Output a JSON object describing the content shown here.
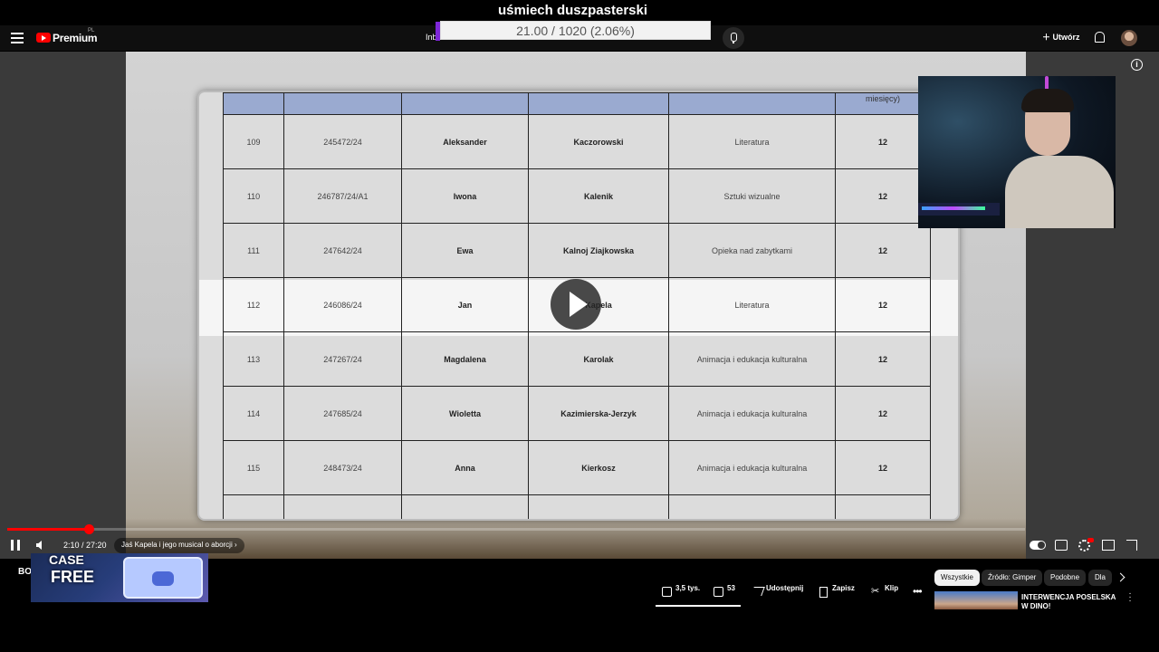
{
  "stream": {
    "title": "uśmiech duszpasterski",
    "progress_text": "21.00 / 1020 (2.06%)",
    "progress_fraction": 0.0206
  },
  "header": {
    "brand": "Premium",
    "region": "PL",
    "search_fragment": "Inb",
    "create_label": "Utwórz"
  },
  "table": {
    "header_last": "miesięcy)",
    "rows": [
      [
        "109",
        "245472/24",
        "Aleksander",
        "Kaczorowski",
        "Literatura",
        "12"
      ],
      [
        "110",
        "246787/24/A1",
        "Iwona",
        "Kalenik",
        "Sztuki wizualne",
        "12"
      ],
      [
        "111",
        "247642/24",
        "Ewa",
        "Kalnoj Ziajkowska",
        "Opieka nad zabytkami",
        "12"
      ],
      [
        "112",
        "246086/24",
        "Jan",
        "Kapela",
        "Literatura",
        "12"
      ],
      [
        "113",
        "247267/24",
        "Magdalena",
        "Karolak",
        "Animacja i edukacja kulturalna",
        "12"
      ],
      [
        "114",
        "247685/24",
        "Wioletta",
        "Kazimierska-Jerzyk",
        "Animacja i edukacja kulturalna",
        "12"
      ],
      [
        "115",
        "248473/24",
        "Anna",
        "Kierkosz",
        "Animacja i edukacja kulturalna",
        "12"
      ]
    ]
  },
  "player": {
    "time": "2:10 / 27:20",
    "chapter": "Jaś Kapela i jego musical o aborcji",
    "played_fraction": 0.08
  },
  "below": {
    "channel_fragment": "BO",
    "promo_line1": "CASE",
    "promo_line2": "FREE",
    "likes": "3,5 tys.",
    "dislikes": "53",
    "share": "Udostępnij",
    "save": "Zapisz",
    "clip": "Klip"
  },
  "chips": [
    "Wszystkie",
    "Źródło: Gimper",
    "Podobne",
    "Dla"
  ],
  "recommendation": {
    "title": "INTERWENCJA POSELSKA W DINO!"
  }
}
